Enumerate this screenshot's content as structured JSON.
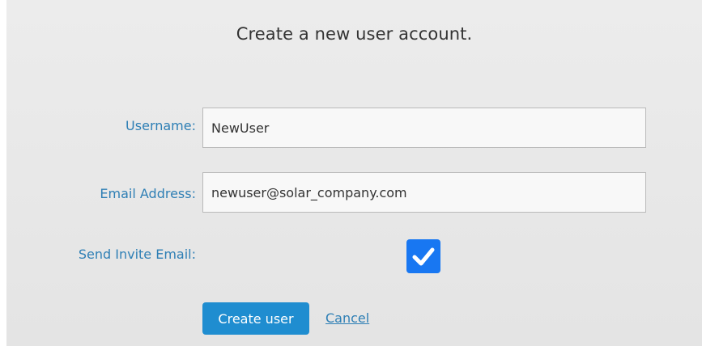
{
  "form": {
    "title": "Create a new user account.",
    "username_label": "Username:",
    "username_value": "NewUser",
    "email_label": "Email Address:",
    "email_value": "newuser@solar_company.com",
    "invite_label": "Send Invite Email:",
    "invite_checked": true,
    "create_button": "Create user",
    "cancel_link": "Cancel"
  },
  "colors": {
    "background": "#e8e8e8",
    "label": "#2e7fb5",
    "checkbox": "#1877f2",
    "button": "#1f8dd0"
  },
  "icons": {
    "checkbox_mark": "checkmark-icon"
  }
}
